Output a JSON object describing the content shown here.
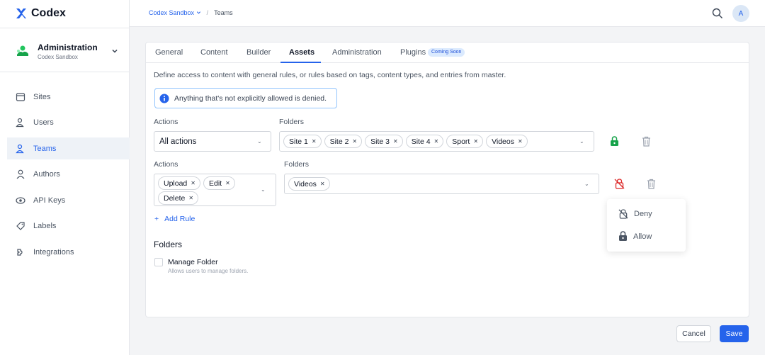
{
  "app": {
    "name": "Codex"
  },
  "org": {
    "name": "Administration",
    "sub": "Codex Sandbox"
  },
  "nav": [
    {
      "label": "Sites",
      "icon": "sites-icon"
    },
    {
      "label": "Users",
      "icon": "users-icon"
    },
    {
      "label": "Teams",
      "icon": "teams-icon",
      "active": true
    },
    {
      "label": "Authors",
      "icon": "authors-icon"
    },
    {
      "label": "API Keys",
      "icon": "api-keys-icon"
    },
    {
      "label": "Labels",
      "icon": "labels-icon"
    },
    {
      "label": "Integrations",
      "icon": "integrations-icon"
    }
  ],
  "breadcrumb": {
    "space": "Codex Sandbox",
    "separator": "/",
    "page": "Teams"
  },
  "user": {
    "initial": "A"
  },
  "tabs": [
    "General",
    "Content",
    "Builder",
    "Assets",
    "Administration",
    "Plugins"
  ],
  "active_tab": "Assets",
  "plugins_badge": "Coming Soon",
  "description": "Define access to content with general rules, or rules based on tags, content types, and entries from master.",
  "notice": "Anything that's not explicitly allowed is denied.",
  "rules": [
    {
      "actions_label": "Actions",
      "actions_value": "All actions",
      "folders_label": "Folders",
      "folders": [
        "Site 1",
        "Site 2",
        "Site 3",
        "Site 4",
        "Sport",
        "Videos"
      ],
      "permission": "allow"
    },
    {
      "actions_label": "Actions",
      "actions": [
        "Upload",
        "Edit",
        "Delete"
      ],
      "folders_label": "Folders",
      "folders": [
        "Videos"
      ],
      "permission": "deny"
    }
  ],
  "add_rule": "Add Rule",
  "folders_section": {
    "title": "Folders",
    "checkbox_label": "Manage Folder",
    "help": "Allows users to manage folders.",
    "checked": false
  },
  "permission_menu": {
    "deny": "Deny",
    "allow": "Allow"
  },
  "buttons": {
    "cancel": "Cancel",
    "save": "Save"
  },
  "colors": {
    "primary": "#2563eb",
    "allow_green": "#16a34a",
    "deny_red": "#dc2626"
  }
}
